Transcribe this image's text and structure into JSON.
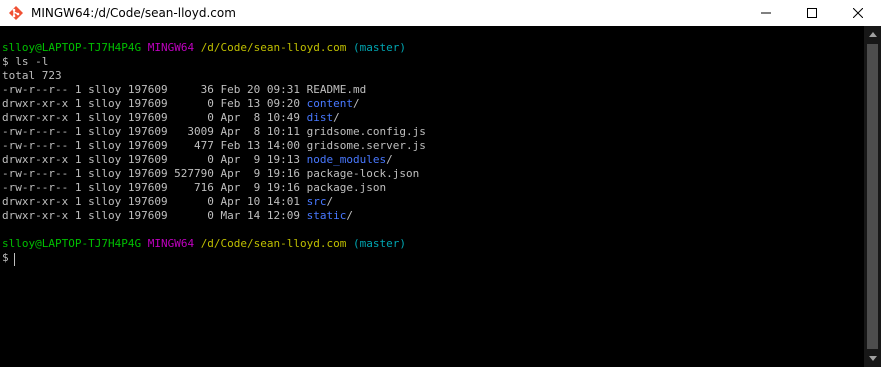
{
  "window": {
    "title": "MINGW64:/d/Code/sean-lloyd.com"
  },
  "icons": {
    "app": "git-bash-icon",
    "minimize": "minimize-icon",
    "maximize": "maximize-icon",
    "close": "close-icon",
    "scroll_up": "scroll-up-icon",
    "scroll_down": "scroll-down-icon"
  },
  "colors": {
    "user": "#00bf00",
    "msys": "#bf00bf",
    "path": "#bfbf00",
    "branch": "#00a6b2",
    "dir": "#4878ff",
    "text": "#bfbfbf"
  },
  "prompt": {
    "user_host": "slloy@LAPTOP-TJ7H4P4G",
    "system": "MINGW64",
    "path": "/d/Code/sean-lloyd.com",
    "branch": "(master)",
    "symbol": "$"
  },
  "command": "ls -l",
  "total": "total 723",
  "entries": [
    {
      "meta": "-rw-r--r-- 1 slloy 197609     36 Feb 20 09:31 ",
      "name": "README.md",
      "suffix": "",
      "is_dir": false
    },
    {
      "meta": "drwxr-xr-x 1 slloy 197609      0 Feb 13 09:20 ",
      "name": "content",
      "suffix": "/",
      "is_dir": true
    },
    {
      "meta": "drwxr-xr-x 1 slloy 197609      0 Apr  8 10:49 ",
      "name": "dist",
      "suffix": "/",
      "is_dir": true
    },
    {
      "meta": "-rw-r--r-- 1 slloy 197609   3009 Apr  8 10:11 ",
      "name": "gridsome.config.js",
      "suffix": "",
      "is_dir": false
    },
    {
      "meta": "-rw-r--r-- 1 slloy 197609    477 Feb 13 14:00 ",
      "name": "gridsome.server.js",
      "suffix": "",
      "is_dir": false
    },
    {
      "meta": "drwxr-xr-x 1 slloy 197609      0 Apr  9 19:13 ",
      "name": "node_modules",
      "suffix": "/",
      "is_dir": true
    },
    {
      "meta": "-rw-r--r-- 1 slloy 197609 527790 Apr  9 19:16 ",
      "name": "package-lock.json",
      "suffix": "",
      "is_dir": false
    },
    {
      "meta": "-rw-r--r-- 1 slloy 197609    716 Apr  9 19:16 ",
      "name": "package.json",
      "suffix": "",
      "is_dir": false
    },
    {
      "meta": "drwxr-xr-x 1 slloy 197609      0 Apr 10 14:01 ",
      "name": "src",
      "suffix": "/",
      "is_dir": true
    },
    {
      "meta": "drwxr-xr-x 1 slloy 197609      0 Mar 14 12:09 ",
      "name": "static",
      "suffix": "/",
      "is_dir": true
    }
  ]
}
